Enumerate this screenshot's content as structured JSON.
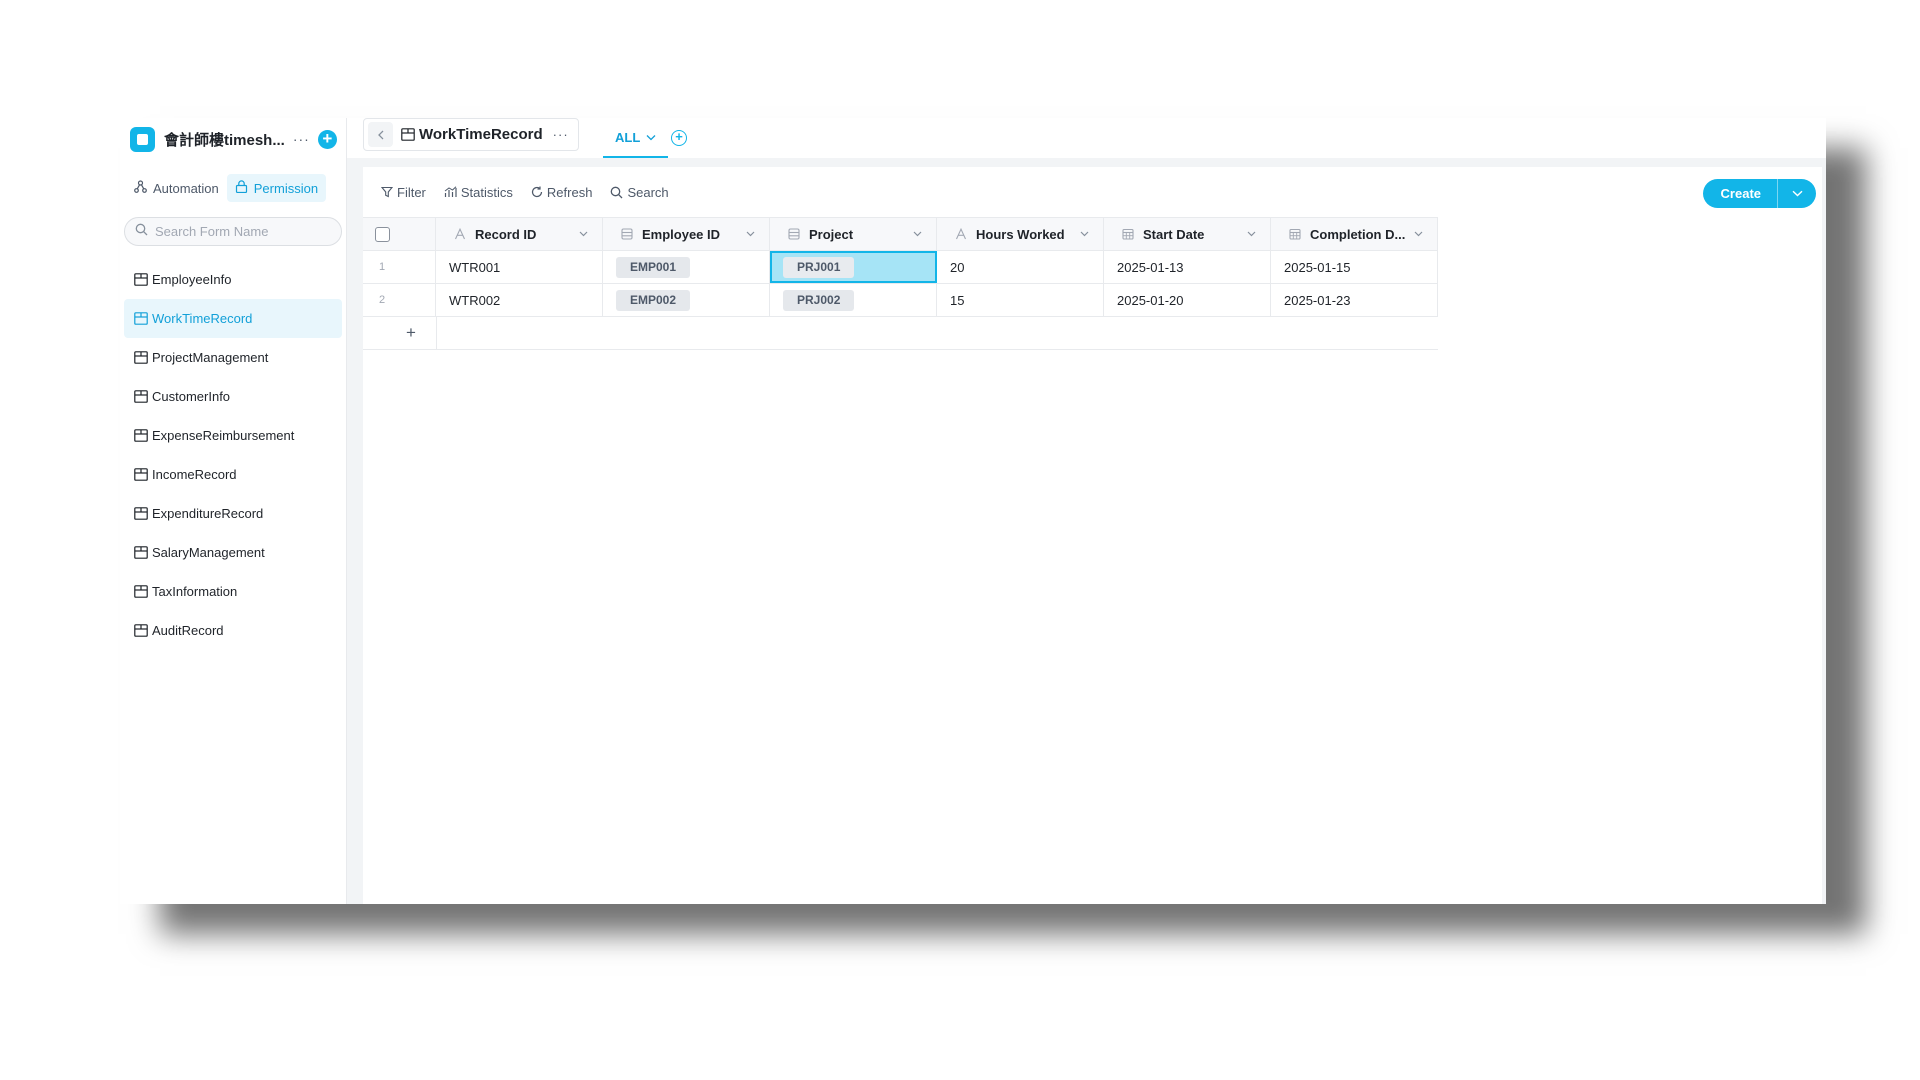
{
  "app": {
    "title": "會計師樓timesh..."
  },
  "sidebar": {
    "mode_tabs": [
      {
        "label": "Automation",
        "icon": "automation-icon",
        "active": false
      },
      {
        "label": "Permission",
        "icon": "lock-icon",
        "active": true
      }
    ],
    "search_placeholder": "Search Form Name",
    "forms": [
      {
        "label": "EmployeeInfo",
        "active": false
      },
      {
        "label": "WorkTimeRecord",
        "active": true
      },
      {
        "label": "ProjectManagement",
        "active": false
      },
      {
        "label": "CustomerInfo",
        "active": false
      },
      {
        "label": "ExpenseReimbursement",
        "active": false
      },
      {
        "label": "IncomeRecord",
        "active": false
      },
      {
        "label": "ExpenditureRecord",
        "active": false
      },
      {
        "label": "SalaryManagement",
        "active": false
      },
      {
        "label": "TaxInformation",
        "active": false
      },
      {
        "label": "AuditRecord",
        "active": false
      }
    ]
  },
  "header": {
    "form_title": "WorkTimeRecord",
    "view_tab": "ALL"
  },
  "toolbar": {
    "filter": "Filter",
    "statistics": "Statistics",
    "refresh": "Refresh",
    "search": "Search",
    "create": "Create"
  },
  "table": {
    "columns": [
      {
        "label": "Record ID",
        "icon": "text-field-icon"
      },
      {
        "label": "Employee ID",
        "icon": "relation-field-icon"
      },
      {
        "label": "Project",
        "icon": "relation-field-icon"
      },
      {
        "label": "Hours Worked",
        "icon": "text-field-icon"
      },
      {
        "label": "Start Date",
        "icon": "calendar-icon"
      },
      {
        "label": "Completion D...",
        "icon": "calendar-icon"
      }
    ],
    "rows": [
      {
        "index": "1",
        "record_id": "WTR001",
        "employee_id": "EMP001",
        "project": "PRJ001",
        "hours": "20",
        "start_date": "2025-01-13",
        "completion_date": "2025-01-15"
      },
      {
        "index": "2",
        "record_id": "WTR002",
        "employee_id": "EMP002",
        "project": "PRJ002",
        "hours": "15",
        "start_date": "2025-01-20",
        "completion_date": "2025-01-23"
      }
    ],
    "add_row": "+"
  },
  "colors": {
    "accent": "#12b5e8",
    "selected_cell": "#a6e4f6",
    "tag_bg": "#e5e8ec"
  }
}
